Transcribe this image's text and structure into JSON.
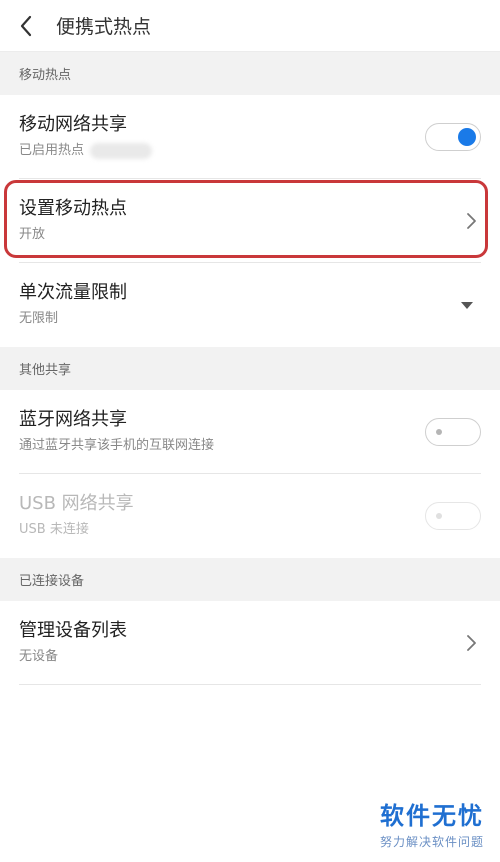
{
  "header": {
    "title": "便携式热点"
  },
  "sections": {
    "hotspot": {
      "header": "移动热点"
    },
    "other": {
      "header": "其他共享"
    },
    "devices": {
      "header": "已连接设备"
    }
  },
  "rows": {
    "mobile_share": {
      "title": "移动网络共享",
      "subtitle": "已启用热点",
      "toggle": "on"
    },
    "setup_hotspot": {
      "title": "设置移动热点",
      "subtitle": "开放"
    },
    "data_limit": {
      "title": "单次流量限制",
      "subtitle": "无限制"
    },
    "bluetooth_share": {
      "title": "蓝牙网络共享",
      "subtitle": "通过蓝牙共享该手机的互联网连接",
      "toggle": "off"
    },
    "usb_share": {
      "title": "USB 网络共享",
      "subtitle": "USB 未连接",
      "toggle": "off-disabled"
    },
    "manage_devices": {
      "title": "管理设备列表",
      "subtitle": "无设备"
    }
  },
  "watermark": {
    "brand": "软件无忧",
    "slogan": "努力解决软件问题"
  },
  "colors": {
    "accent": "#1a7ae8",
    "highlight": "#c9383a",
    "section_bg": "#f2f2f2"
  }
}
